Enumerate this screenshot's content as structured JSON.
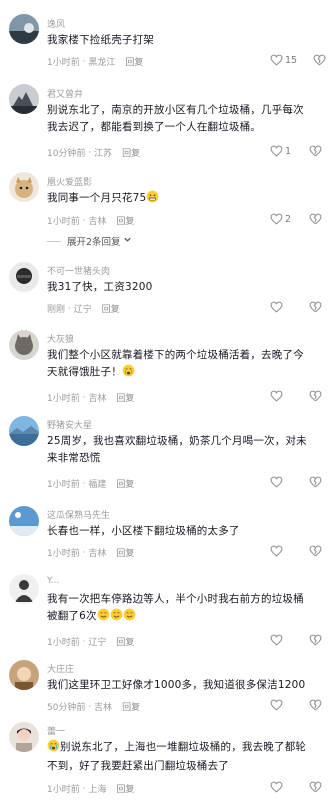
{
  "comments": [
    {
      "user": "逸风",
      "text": "我家楼下捡纸壳子打架",
      "time": "1小时前",
      "location": "黑龙江",
      "reply": "回复",
      "likes": "15"
    },
    {
      "user": "君又曾弁",
      "text": "别说东北了，南京的开放小区有几个垃圾桶，几乎每次我去迟了，都能看到换了一个人在翻垃圾桶。",
      "time": "10分钟前",
      "location": "江苏",
      "reply": "回复",
      "likes": "1"
    },
    {
      "user": "凰火爱蓝影",
      "text": "我同事一个月只花75",
      "time": "1小时前",
      "location": "吉林",
      "reply": "回复",
      "likes": "2"
    },
    {
      "user": "不可一世猪头肉",
      "text": "我31了快，工资3200",
      "time": "刚刚",
      "location": "辽宁",
      "reply": "回复",
      "likes": ""
    },
    {
      "user": "大灰狼",
      "text": "我们整个小区就靠着楼下的两个垃圾桶活着，去晚了今天就得饿肚子！",
      "time": "1小时前",
      "location": "吉林",
      "reply": "回复",
      "likes": ""
    },
    {
      "user": "野猪安大星",
      "text": "25周岁，我也喜欢翻垃圾桶，奶茶几个月喝一次，对未来非常恐慌",
      "time": "1小时前",
      "location": "福建",
      "reply": "回复",
      "likes": ""
    },
    {
      "user": "这瓜保熟马先生",
      "text": "长春也一样，小区楼下翻垃圾桶的太多了",
      "time": "1小时前",
      "location": "吉林",
      "reply": "回复",
      "likes": ""
    },
    {
      "user": "Y...",
      "text": "我有一次把车停路边等人，半个小时我右前方的垃圾桶被翻了6次",
      "time": "1小时前",
      "location": "辽宁",
      "reply": "回复",
      "likes": ""
    },
    {
      "user": "大庄庄",
      "text": "我们这里环卫工好像才1000多，我知道很多保洁1200",
      "time": "50分钟前",
      "location": "吉林",
      "reply": "回复",
      "likes": ""
    },
    {
      "user": "蕾一",
      "text": "别说东北了，上海也一堆翻垃圾桶的，我去晚了都轮不到，好了我要赶紧出门翻垃圾桶去了",
      "time": "1小时前",
      "location": "上海",
      "reply": "回复",
      "likes": ""
    }
  ],
  "expand_replies": "展开2条回复",
  "icons": {
    "like": "heart-outline-icon",
    "dislike": "broken-heart-icon",
    "expand": "chevron-down-icon"
  }
}
